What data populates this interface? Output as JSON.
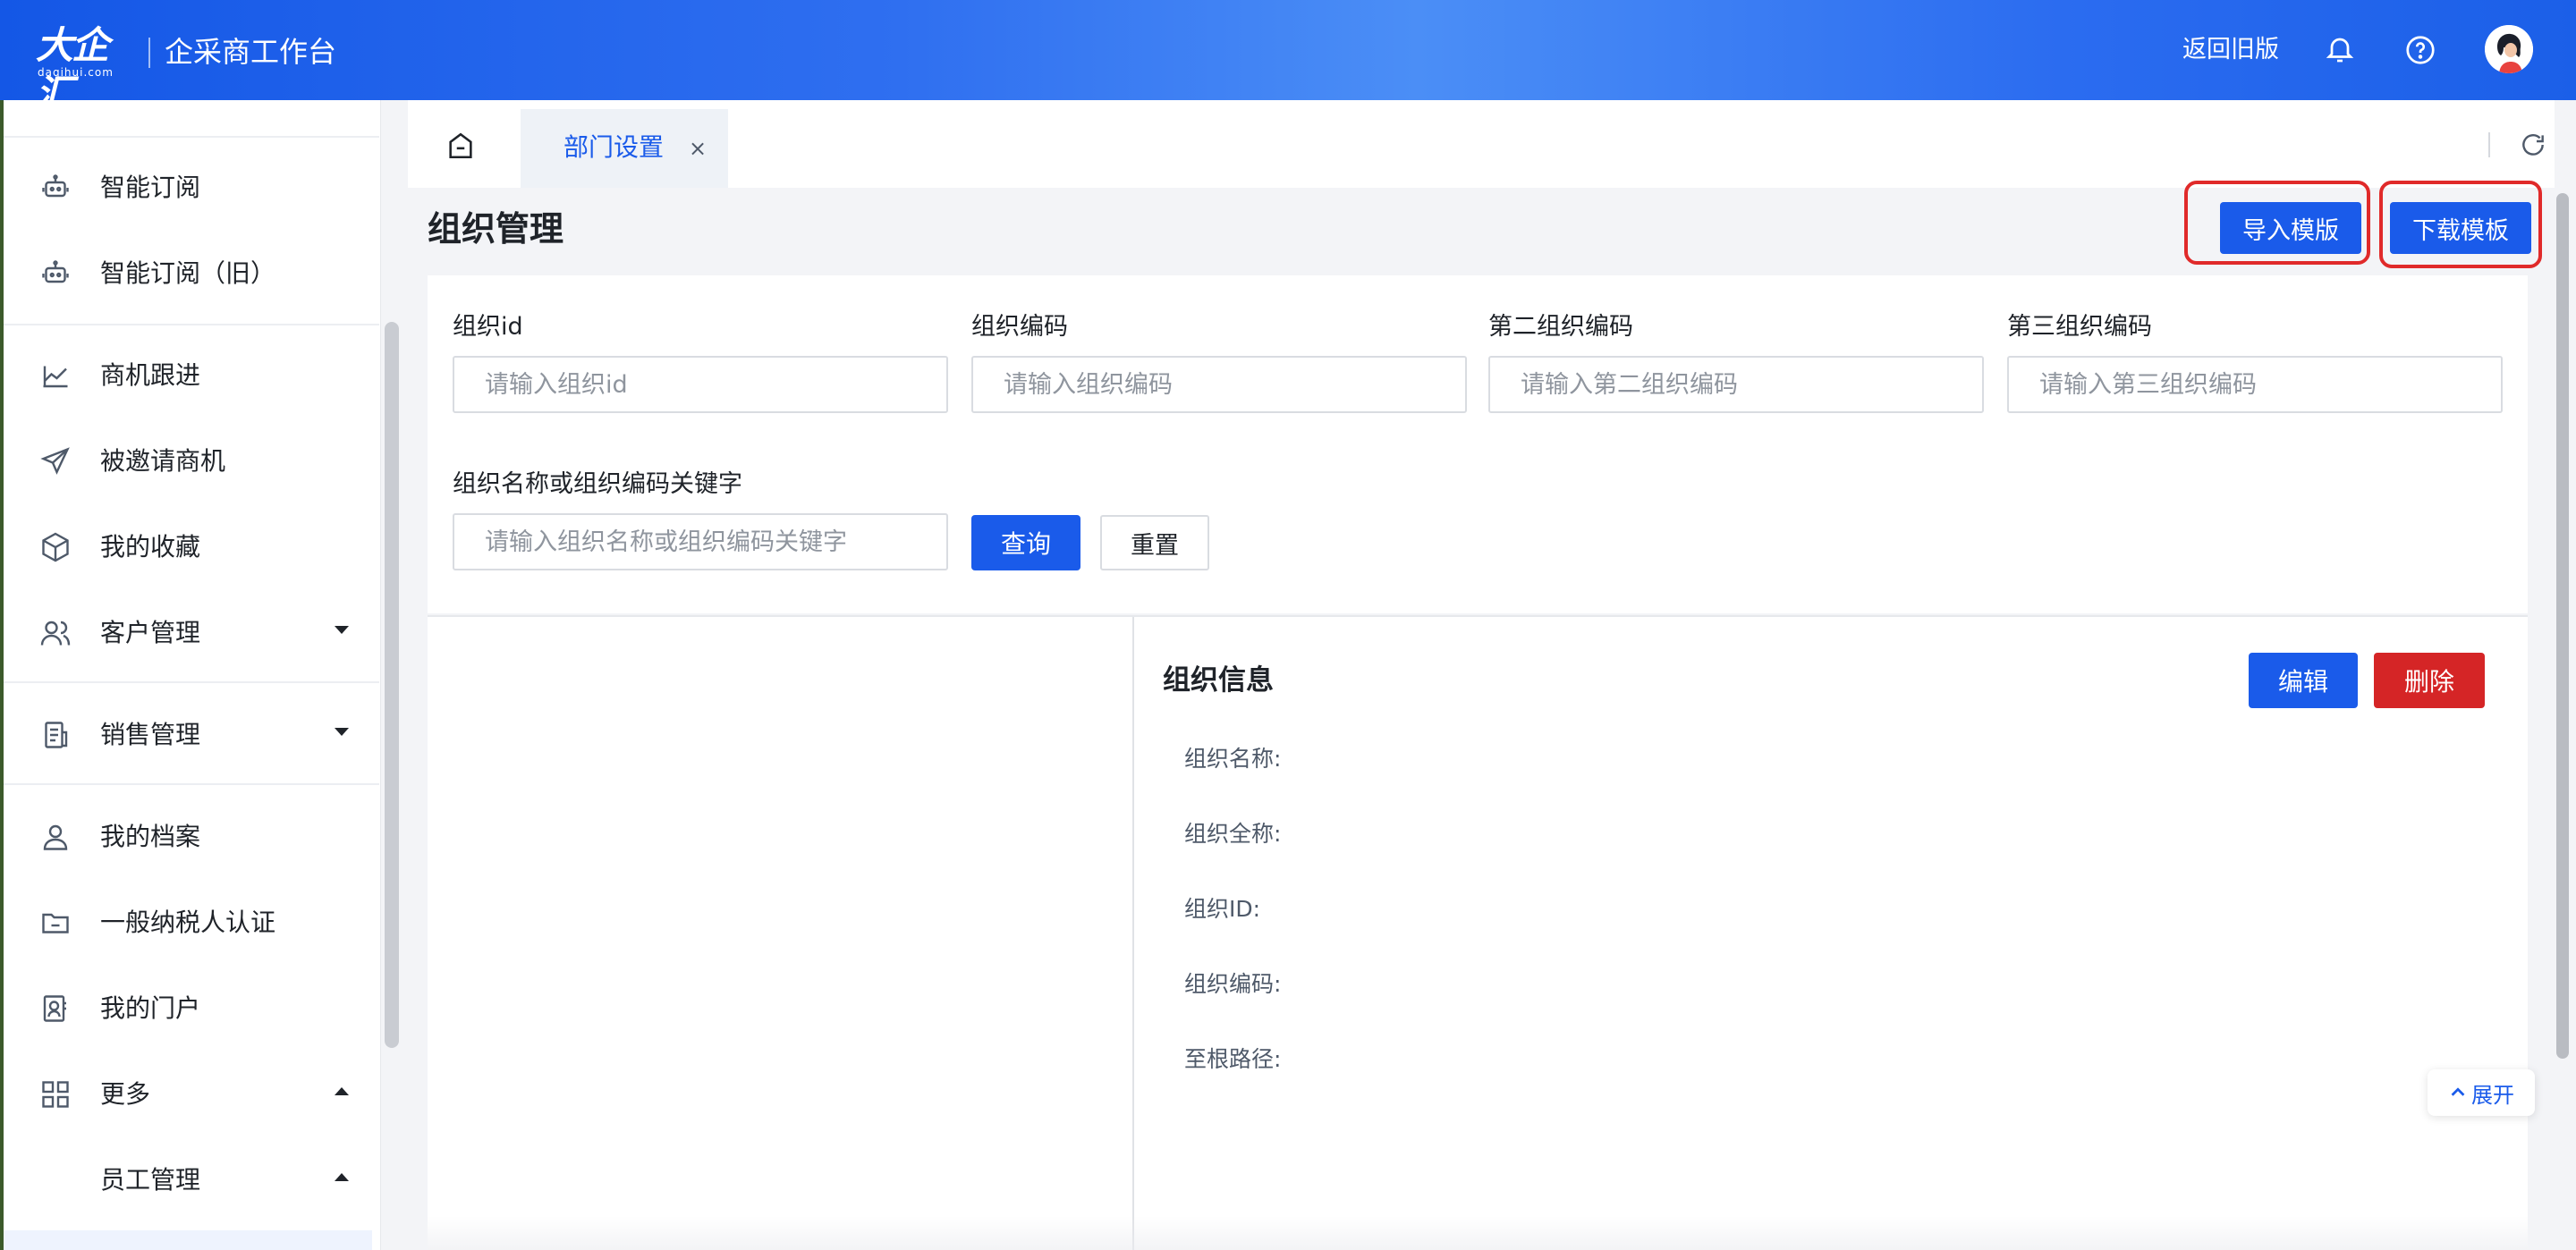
{
  "header": {
    "logo_text": "大企汇",
    "logo_sub": "daqihui.com",
    "app_title": "企采商工作台",
    "return_old_label": "返回旧版",
    "icons": {
      "bell": "bell-icon",
      "help": "help-icon",
      "avatar": "avatar"
    }
  },
  "sidebar": {
    "items": [
      {
        "label": "智能订阅",
        "icon": "robot-icon"
      },
      {
        "label": "智能订阅（旧）",
        "icon": "robot-icon"
      },
      {
        "label": "商机跟进",
        "icon": "chart-icon"
      },
      {
        "label": "被邀请商机",
        "icon": "send-icon"
      },
      {
        "label": "我的收藏",
        "icon": "cube-icon"
      },
      {
        "label": "客户管理",
        "icon": "users-icon",
        "expanded": false
      },
      {
        "label": "销售管理",
        "icon": "document-icon",
        "expanded": false
      },
      {
        "label": "我的档案",
        "icon": "user-icon"
      },
      {
        "label": "一般纳税人认证",
        "icon": "folder-icon"
      },
      {
        "label": "我的门户",
        "icon": "portal-icon"
      },
      {
        "label": "更多",
        "icon": "grid-icon",
        "expanded": true
      },
      {
        "label": "员工管理",
        "icon": "",
        "expanded": true
      }
    ]
  },
  "tabs": {
    "home_icon": "home-icon",
    "active": {
      "label": "部门设置",
      "close": "×"
    },
    "refresh_icon": "refresh-icon"
  },
  "page": {
    "title": "组织管理",
    "import_label": "导入模版",
    "download_label": "下载模板"
  },
  "search": {
    "fields": [
      {
        "label": "组织id",
        "placeholder": "请输入组织id"
      },
      {
        "label": "组织编码",
        "placeholder": "请输入组织编码"
      },
      {
        "label": "第二组织编码",
        "placeholder": "请输入第二组织编码"
      },
      {
        "label": "第三组织编码",
        "placeholder": "请输入第三组织编码"
      },
      {
        "label": "组织名称或组织编码关键字",
        "placeholder": "请输入组织名称或组织编码关键字"
      }
    ],
    "query_label": "查询",
    "reset_label": "重置"
  },
  "info": {
    "title": "组织信息",
    "edit_label": "编辑",
    "delete_label": "删除",
    "fields": [
      "组织名称:",
      "组织全称:",
      "组织ID:",
      "组织编码:",
      "至根路径:"
    ],
    "expand_label": "展开"
  },
  "colors": {
    "primary": "#1a5bea",
    "danger": "#d52526",
    "highlight": "#e02a2a"
  }
}
